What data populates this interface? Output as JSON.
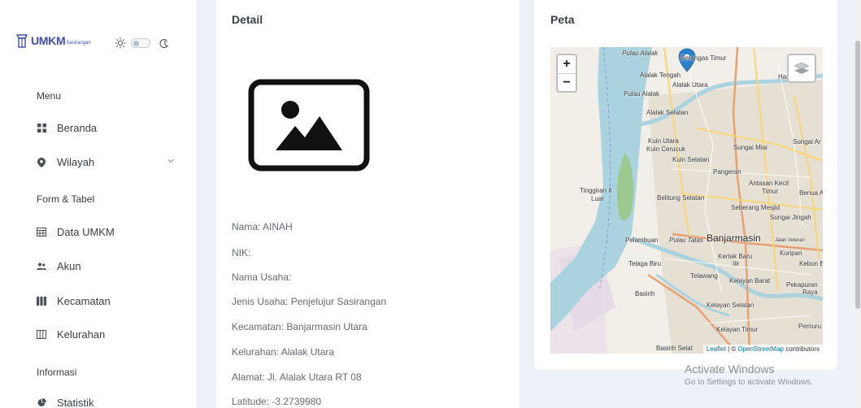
{
  "brand": {
    "name": "UMKM",
    "sub": "Sasirangan"
  },
  "sidebar": {
    "sections": [
      {
        "title": "Menu"
      },
      {
        "title": "Form & Tabel"
      },
      {
        "title": "Informasi"
      }
    ],
    "items": [
      {
        "label": "Beranda",
        "icon": "grid-icon"
      },
      {
        "label": "Wilayah",
        "icon": "map-pin-icon"
      },
      {
        "label": "Data UMKM",
        "icon": "table-icon"
      },
      {
        "label": "Akun",
        "icon": "users-icon"
      },
      {
        "label": "Kecamatan",
        "icon": "columns-icon"
      },
      {
        "label": "Kelurahan",
        "icon": "columns-outline-icon"
      },
      {
        "label": "Statistik",
        "icon": "pie-chart-icon"
      }
    ]
  },
  "detail": {
    "title": "Detail",
    "fields": [
      "Nama: AINAH",
      "NIK:",
      "Nama Usaha:",
      "Jenis Usaha: Penjelujur Sasirangan",
      "Kecamatan: Banjarmasin Utara",
      "Kelurahan: Alalak Utara",
      "Alamat: Jl. Alalak Utara RT 08",
      "Latitude: -3.2739980"
    ]
  },
  "map": {
    "title": "Peta",
    "zoom_in": "+",
    "zoom_out": "−",
    "attribution": {
      "leaflet": "Leaflet",
      "sep": " | © ",
      "osm": "OpenStreetMap",
      "suffix": " contributors"
    },
    "labels": [
      "Pulau Alalak",
      "Berangas Timur",
      "Alalak Tengah",
      "Alalak Utara",
      "Handil",
      "Pulau Alalak",
      "Alalak Selatan",
      "Kuin Utara",
      "Kuin Cerucuk",
      "Sungai Miai",
      "Sungai Ar",
      "Kuin Selatan",
      "Pangeran",
      "Antasan Kecil",
      "Timur",
      "Tinggiran II",
      "Luar",
      "Belitung Selatan",
      "Benua A",
      "Seberang Mesjid",
      "Sungai Jingah",
      "Pelambuan",
      "Pulau Tatas",
      "Banjarmasin",
      "Jalan Veteran",
      "Kertak Baru",
      "Kuripan",
      "Telaga Biru",
      "Ilir",
      "Kebun Bu",
      "Telawang",
      "Kelayan Barat",
      "Pekapuran",
      "Raya",
      "Basirih",
      "Kelayan Selatan",
      "Kelayan Timur",
      "Pemuru",
      "Basirih Selat"
    ],
    "accent_water": "#aad3df",
    "marker_color": "#2a81cb"
  },
  "watermark": {
    "line1": "Activate Windows",
    "line2": "Go to Settings to activate Windows."
  }
}
